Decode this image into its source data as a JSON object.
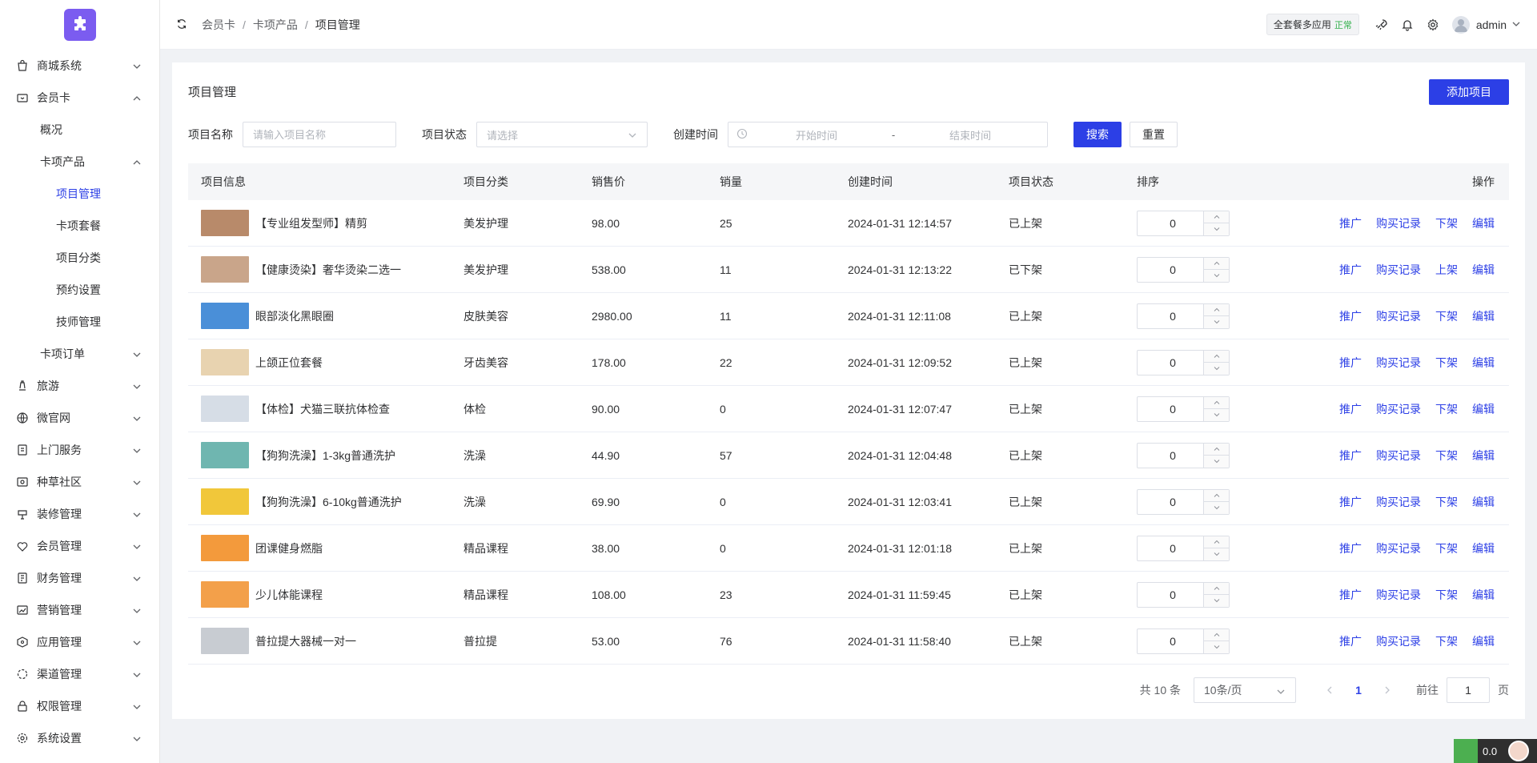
{
  "sidebar": {
    "items": [
      {
        "label": "商城系统",
        "icon": "bag-icon",
        "level": 0,
        "arrow": "down"
      },
      {
        "label": "会员卡",
        "icon": "card-icon",
        "level": 0,
        "arrow": "up"
      },
      {
        "label": "概况",
        "level": 1
      },
      {
        "label": "卡项产品",
        "level": 1,
        "arrow": "up"
      },
      {
        "label": "项目管理",
        "level": 2,
        "active": true
      },
      {
        "label": "卡项套餐",
        "level": 2
      },
      {
        "label": "项目分类",
        "level": 2
      },
      {
        "label": "预约设置",
        "level": 2
      },
      {
        "label": "技师管理",
        "level": 2
      },
      {
        "label": "卡项订单",
        "level": 1,
        "arrow": "down"
      },
      {
        "label": "旅游",
        "icon": "travel-icon",
        "level": 0,
        "arrow": "down"
      },
      {
        "label": "微官网",
        "icon": "globe-icon",
        "level": 0,
        "arrow": "down"
      },
      {
        "label": "上门服务",
        "icon": "service-icon",
        "level": 0,
        "arrow": "down"
      },
      {
        "label": "种草社区",
        "icon": "community-icon",
        "level": 0,
        "arrow": "down"
      },
      {
        "label": "装修管理",
        "icon": "decor-icon",
        "level": 0,
        "arrow": "down"
      },
      {
        "label": "会员管理",
        "icon": "member-icon",
        "level": 0,
        "arrow": "down"
      },
      {
        "label": "财务管理",
        "icon": "finance-icon",
        "level": 0,
        "arrow": "down"
      },
      {
        "label": "营销管理",
        "icon": "marketing-icon",
        "level": 0,
        "arrow": "down"
      },
      {
        "label": "应用管理",
        "icon": "app-icon",
        "level": 0,
        "arrow": "down"
      },
      {
        "label": "渠道管理",
        "icon": "channel-icon",
        "level": 0,
        "arrow": "down"
      },
      {
        "label": "权限管理",
        "icon": "lock-icon",
        "level": 0,
        "arrow": "down"
      },
      {
        "label": "系统设置",
        "icon": "gear-icon",
        "level": 0,
        "arrow": "down"
      }
    ]
  },
  "header": {
    "breadcrumb": [
      "会员卡",
      "卡项产品",
      "项目管理"
    ],
    "plan_label": "全套餐多应用",
    "plan_status": "正常",
    "username": "admin"
  },
  "main": {
    "title": "项目管理",
    "add_button": "添加项目",
    "filters": {
      "name_label": "项目名称",
      "name_placeholder": "请输入项目名称",
      "status_label": "项目状态",
      "status_placeholder": "请选择",
      "time_label": "创建时间",
      "start_placeholder": "开始时间",
      "date_sep": "-",
      "end_placeholder": "结束时间",
      "search_button": "搜索",
      "reset_button": "重置"
    },
    "table": {
      "columns": [
        "项目信息",
        "项目分类",
        "销售价",
        "销量",
        "创建时间",
        "项目状态",
        "排序",
        "操作"
      ],
      "rows": [
        {
          "name": "【专业组发型师】精剪",
          "category": "美发护理",
          "price": "98.00",
          "sales": "25",
          "created": "2024-01-31 12:14:57",
          "status": "已上架",
          "sort": "0",
          "toggle": "下架",
          "thumb": "#b88a6a"
        },
        {
          "name": "【健康烫染】奢华烫染二选一",
          "category": "美发护理",
          "price": "538.00",
          "sales": "11",
          "created": "2024-01-31 12:13:22",
          "status": "已下架",
          "sort": "0",
          "toggle": "上架",
          "thumb": "#c9a58a"
        },
        {
          "name": "眼部淡化黑眼圈",
          "category": "皮肤美容",
          "price": "2980.00",
          "sales": "11",
          "created": "2024-01-31 12:11:08",
          "status": "已上架",
          "sort": "0",
          "toggle": "下架",
          "thumb": "#4a8fd8"
        },
        {
          "name": "上颌正位套餐",
          "category": "牙齿美容",
          "price": "178.00",
          "sales": "22",
          "created": "2024-01-31 12:09:52",
          "status": "已上架",
          "sort": "0",
          "toggle": "下架",
          "thumb": "#e8d3b0"
        },
        {
          "name": "【体检】犬猫三联抗体检查",
          "category": "体检",
          "price": "90.00",
          "sales": "0",
          "created": "2024-01-31 12:07:47",
          "status": "已上架",
          "sort": "0",
          "toggle": "下架",
          "thumb": "#d6dde6"
        },
        {
          "name": "【狗狗洗澡】1-3kg普通洗护",
          "category": "洗澡",
          "price": "44.90",
          "sales": "57",
          "created": "2024-01-31 12:04:48",
          "status": "已上架",
          "sort": "0",
          "toggle": "下架",
          "thumb": "#6fb6b0"
        },
        {
          "name": "【狗狗洗澡】6-10kg普通洗护",
          "category": "洗澡",
          "price": "69.90",
          "sales": "0",
          "created": "2024-01-31 12:03:41",
          "status": "已上架",
          "sort": "0",
          "toggle": "下架",
          "thumb": "#f1c73a"
        },
        {
          "name": "团课健身燃脂",
          "category": "精品课程",
          "price": "38.00",
          "sales": "0",
          "created": "2024-01-31 12:01:18",
          "status": "已上架",
          "sort": "0",
          "toggle": "下架",
          "thumb": "#f39a3c"
        },
        {
          "name": "少儿体能课程",
          "category": "精品课程",
          "price": "108.00",
          "sales": "23",
          "created": "2024-01-31 11:59:45",
          "status": "已上架",
          "sort": "0",
          "toggle": "下架",
          "thumb": "#f3a04a"
        },
        {
          "name": "普拉提大器械一对一",
          "category": "普拉提",
          "price": "53.00",
          "sales": "76",
          "created": "2024-01-31 11:58:40",
          "status": "已上架",
          "sort": "0",
          "toggle": "下架",
          "thumb": "#c8ccd2"
        }
      ],
      "actions": {
        "promote": "推广",
        "records": "购买记录",
        "edit": "编辑"
      }
    },
    "pagination": {
      "total": "共 10 条",
      "page_size": "10条/页",
      "current": "1",
      "goto_label": "前往",
      "goto_value": "1",
      "page_unit": "页"
    }
  },
  "widget": {
    "text": "0.0"
  },
  "colors": {
    "primary": "#2c3fe6",
    "logo": "#7b5cf0",
    "status_ok": "#33b14c"
  }
}
